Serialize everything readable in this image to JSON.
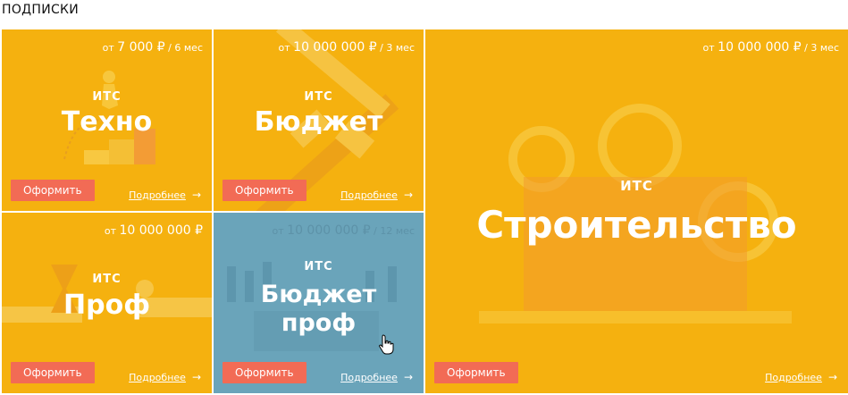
{
  "heading": "ПОДПИСКИ",
  "cards": [
    {
      "id": "tehno",
      "price_prefix": "от ",
      "price_amount": "7 000 ₽",
      "price_period": " / 6 мес",
      "label": "ИТС",
      "title": "Техно",
      "order": "Оформить",
      "more": "Подробнее",
      "arrow": "→"
    },
    {
      "id": "budget",
      "price_prefix": "от ",
      "price_amount": "10 000 000 ₽",
      "price_period": " / 3 мес",
      "label": "ИТС",
      "title": "Бюджет",
      "order": "Оформить",
      "more": "Подробнее",
      "arrow": "→"
    },
    {
      "id": "stroitelstvo",
      "price_prefix": "от ",
      "price_amount": "10 000 000 ₽",
      "price_period": " / 3 мес",
      "label": "ИТС",
      "title": "Строительство",
      "order": "Оформить",
      "more": "Подробнее",
      "arrow": "→"
    },
    {
      "id": "prof",
      "price_prefix": "от ",
      "price_amount": "10 000 000 ₽",
      "price_period": "",
      "label": "ИТС",
      "title": "Проф",
      "order": "Оформить",
      "more": "Подробнее",
      "arrow": "→"
    },
    {
      "id": "budget-prof",
      "price_prefix": "от ",
      "price_amount": "10 000 000 ₽",
      "price_period": " / 12 мес",
      "label": "ИТС",
      "title_line1": "Бюджет",
      "title_line2": "проф",
      "order": "Оформить",
      "more": "Подробнее",
      "arrow": "→"
    }
  ],
  "colors": {
    "card": "#f5b10f",
    "card_hover": "#6aa4ba",
    "button": "#f26b55"
  },
  "icons": [
    "arrow-right-icon",
    "hand-cursor-icon"
  ]
}
